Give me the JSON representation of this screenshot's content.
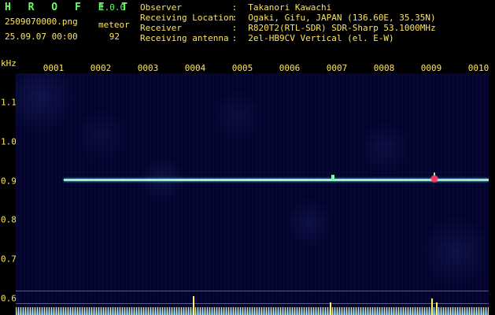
{
  "header": {
    "app_title": "H R O F F T",
    "app_version": "1.0.0",
    "file_name": "2509070000.png",
    "date_time": "25.09.07 00:00",
    "meteor_label": "meteor",
    "meteor_count": "92"
  },
  "info": {
    "observer_label": "Observer",
    "observer_value": "Takanori Kawachi",
    "location_label": "Receiving Location",
    "location_value": "Ogaki, Gifu, JAPAN (136.60E, 35.35N)",
    "receiver_label": "Receiver",
    "receiver_value": "R820T2(RTL-SDR) SDR-Sharp 53.1000MHz",
    "antenna_label": "Receiving antenna",
    "antenna_value": "2el-HB9CV Vertical (el. E-W)",
    "separator": ":"
  },
  "axes": {
    "unit": "kHz",
    "time_labels": [
      "0001",
      "0002",
      "0003",
      "0004",
      "0005",
      "0006",
      "0007",
      "0008",
      "0009",
      "0010"
    ],
    "frequency_labels": [
      "1.1",
      "1.0",
      "0.9",
      "0.8",
      "0.7",
      "0.6"
    ]
  },
  "colors": {
    "title": "#67ff67",
    "text": "#ffe45a",
    "background": "#000000",
    "spectrogram": "#02022b",
    "signal": "#8fefff",
    "meteor": "#ff3366"
  }
}
